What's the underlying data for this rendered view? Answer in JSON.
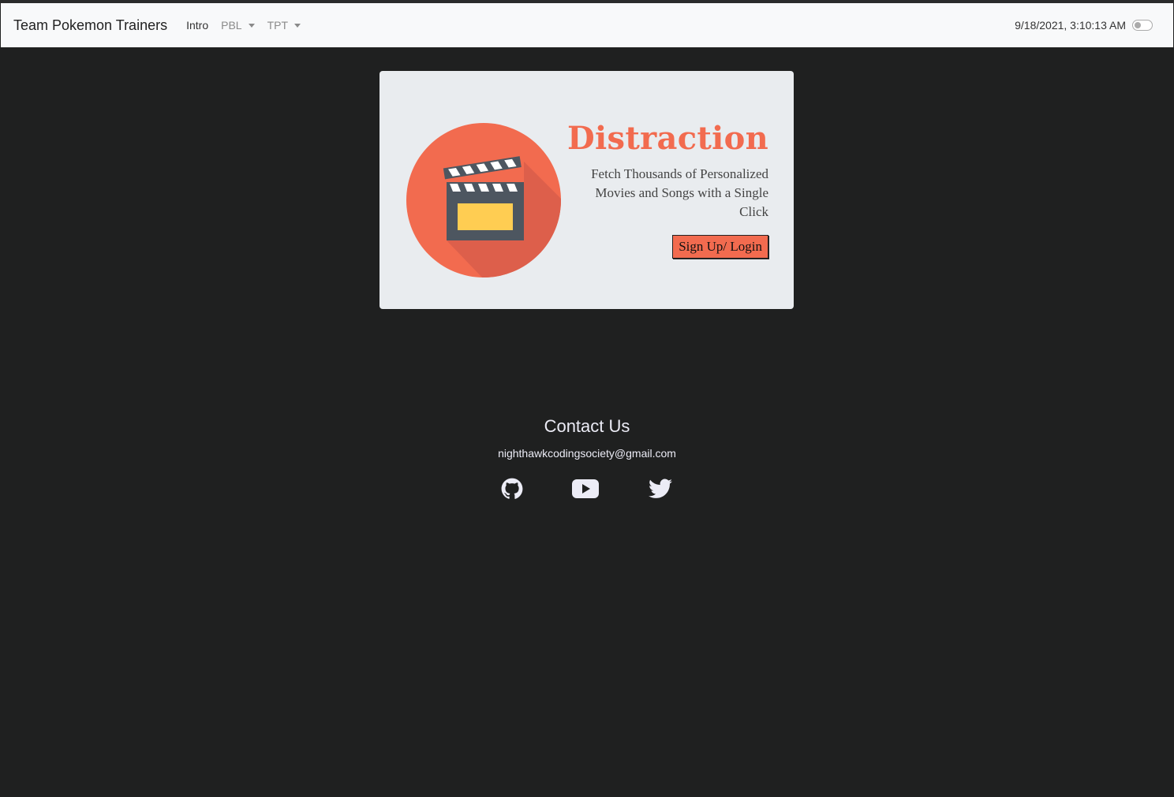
{
  "navbar": {
    "brand": "Team Pokemon Trainers",
    "items": [
      {
        "label": "Intro"
      },
      {
        "label": "PBL"
      },
      {
        "label": "TPT"
      }
    ],
    "clock": "9/18/2021, 3:10:13 AM"
  },
  "hero": {
    "title": "Distraction",
    "subtitle": "Fetch Thousands of Personalized Movies and Songs with a Single Click",
    "button": "Sign Up/ Login",
    "logo_icon": "clapperboard-icon",
    "accent": "#f26b4f"
  },
  "contact": {
    "heading": "Contact Us",
    "email": "nighthawkcodingsociety@gmail.com",
    "socials": [
      {
        "icon": "github-icon"
      },
      {
        "icon": "youtube-icon"
      },
      {
        "icon": "twitter-icon"
      }
    ]
  },
  "colors": {
    "background": "#1f2020",
    "navbar": "#f8f9fa",
    "card": "#e9ecef",
    "footer_text": "#ececf6"
  }
}
